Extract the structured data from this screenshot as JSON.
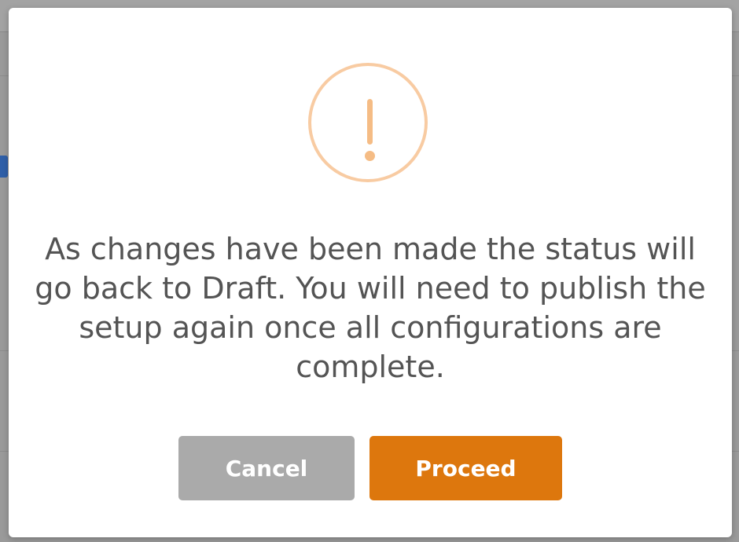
{
  "dialog": {
    "message": "As changes have been made the status will go back to Draft. You will need to publish the setup again once all configurations are complete.",
    "cancel_label": "Cancel",
    "proceed_label": "Proceed",
    "icon": "warning-exclamation-icon"
  },
  "colors": {
    "proceed_button": "#dd770d",
    "cancel_button": "#aaaaaa",
    "warning_icon": "#f5bc85",
    "text": "#545454"
  }
}
